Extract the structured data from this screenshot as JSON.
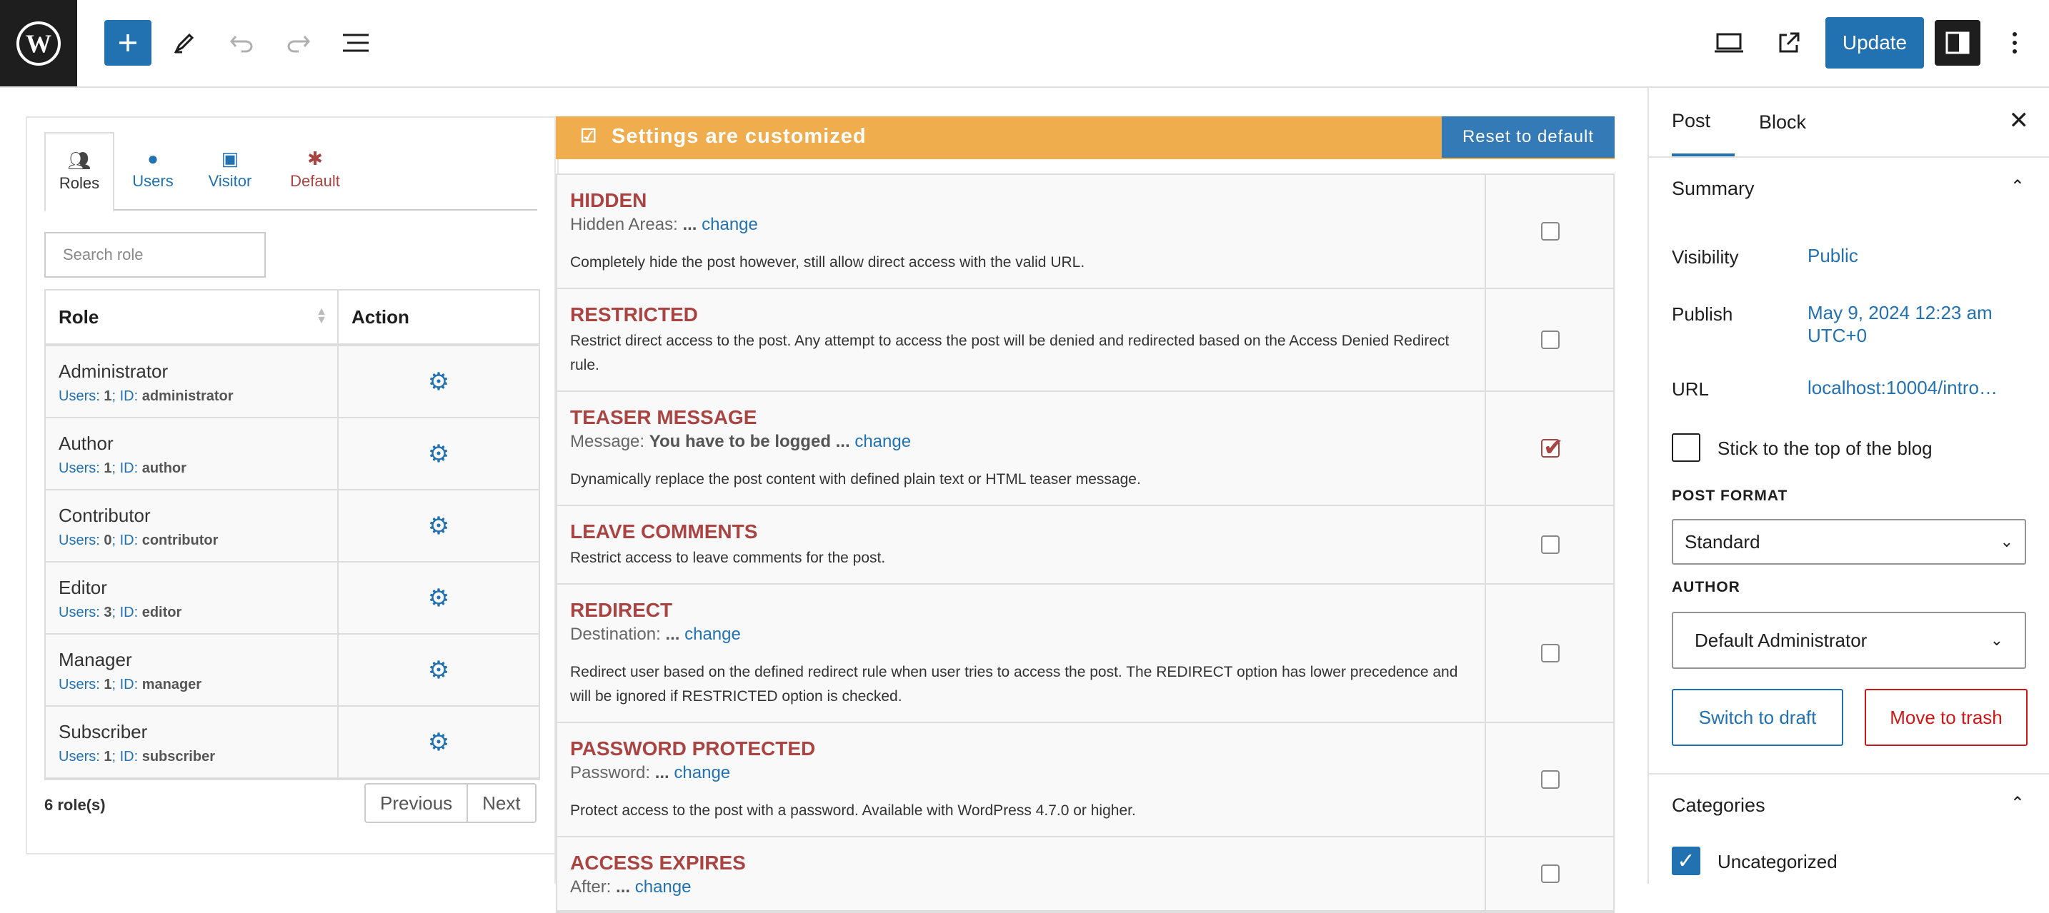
{
  "toolbar": {
    "update_label": "Update",
    "icons": [
      "wordpress-logo",
      "plus",
      "pencil",
      "undo",
      "redo",
      "list-view",
      "desktop-preview",
      "external-link",
      "sidebar",
      "more-vertical"
    ]
  },
  "roles_panel": {
    "tabs": [
      {
        "label": "Roles",
        "icon": "users-icon"
      },
      {
        "label": "Users",
        "icon": "user-icon"
      },
      {
        "label": "Visitor",
        "icon": "visitor-icon"
      },
      {
        "label": "Default",
        "icon": "asterisk-icon"
      }
    ],
    "search_placeholder": "Search role",
    "columns": [
      "Role",
      "Action"
    ],
    "rows": [
      {
        "name": "Administrator",
        "users_label": "Users:",
        "users": "1",
        "id_label": "; ID:",
        "id": "administrator"
      },
      {
        "name": "Author",
        "users_label": "Users:",
        "users": "1",
        "id_label": "; ID:",
        "id": "author"
      },
      {
        "name": "Contributor",
        "users_label": "Users:",
        "users": "0",
        "id_label": "; ID:",
        "id": "contributor"
      },
      {
        "name": "Editor",
        "users_label": "Users:",
        "users": "3",
        "id_label": "; ID:",
        "id": "editor"
      },
      {
        "name": "Manager",
        "users_label": "Users:",
        "users": "1",
        "id_label": "; ID:",
        "id": "manager"
      },
      {
        "name": "Subscriber",
        "users_label": "Users:",
        "users": "1",
        "id_label": "; ID:",
        "id": "subscriber"
      }
    ],
    "count": "6 role(s)",
    "prev_label": "Previous",
    "next_label": "Next"
  },
  "access": {
    "banner_text": "Settings are customized",
    "reset_label": "Reset to default",
    "options": [
      {
        "title": "HIDDEN",
        "sub_label": "Hidden Areas:",
        "sub_value": "...",
        "link": "change",
        "desc": "Completely hide the post however, still allow direct access with the valid URL.",
        "checked": false
      },
      {
        "title": "RESTRICTED",
        "desc": "Restrict direct access to the post. Any attempt to access the post will be denied and redirected based on the Access Denied Redirect rule.",
        "checked": false
      },
      {
        "title": "TEASER MESSAGE",
        "sub_label": "Message:",
        "sub_value": "You have to be logged ...",
        "link": "change",
        "desc": "Dynamically replace the post content with defined plain text or HTML teaser message.",
        "checked": true
      },
      {
        "title": "LEAVE COMMENTS",
        "desc": "Restrict access to leave comments for the post.",
        "checked": false
      },
      {
        "title": "REDIRECT",
        "sub_label": "Destination:",
        "sub_value": "...",
        "link": "change",
        "desc": "Redirect user based on the defined redirect rule when user tries to access the post. The REDIRECT option has lower precedence and will be ignored if RESTRICTED option is checked.",
        "checked": false
      },
      {
        "title": "PASSWORD PROTECTED",
        "sub_label": "Password:",
        "sub_value": "...",
        "link": "change",
        "desc": "Protect access to the post with a password. Available with WordPress 4.7.0 or higher.",
        "checked": false
      },
      {
        "title": "ACCESS EXPIRES",
        "sub_label": "After:",
        "sub_value": "...",
        "link": "change",
        "desc": "",
        "checked": false
      }
    ]
  },
  "sidebar": {
    "tabs": [
      "Post",
      "Block"
    ],
    "summary_title": "Summary",
    "visibility_label": "Visibility",
    "visibility_value": "Public",
    "publish_label": "Publish",
    "publish_value": "May 9, 2024 12:23 am UTC+0",
    "url_label": "URL",
    "url_value": "localhost:10004/intro…",
    "sticky_label": "Stick to the top of the blog",
    "post_format_label": "POST FORMAT",
    "post_format_value": "Standard",
    "author_label": "AUTHOR",
    "author_value": "Default Administrator",
    "switch_draft_label": "Switch to draft",
    "trash_label": "Move to trash",
    "categories_title": "Categories",
    "category_item": "Uncategorized"
  },
  "colors": {
    "accent": "#2271b1",
    "banner": "#f0ad4e",
    "danger": "#a94442",
    "reset_btn": "#337ab7"
  }
}
